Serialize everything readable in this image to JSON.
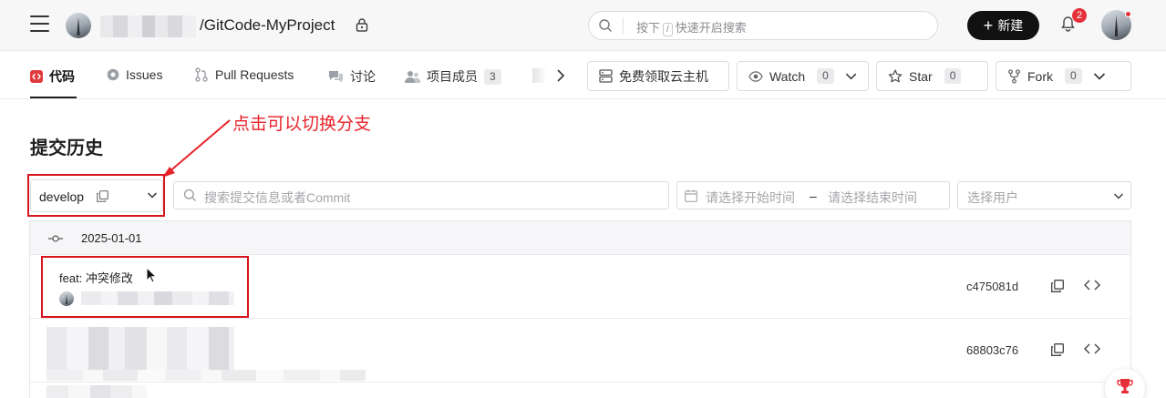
{
  "header": {
    "repo_name": "GitCode-MyProject",
    "search_placeholder_pre": "按下",
    "search_key": "/",
    "search_placeholder_post": "快速开启搜索",
    "new_label": "新建",
    "notification_count": "2"
  },
  "tabs": [
    {
      "label": "代码"
    },
    {
      "label": "Issues"
    },
    {
      "label": "Pull Requests"
    },
    {
      "label": "讨论"
    },
    {
      "label": "项目成员",
      "count": "3"
    }
  ],
  "actions": {
    "cloud_label": "免费领取云主机",
    "watch_label": "Watch",
    "watch_count": "0",
    "star_label": "Star",
    "star_count": "0",
    "fork_label": "Fork",
    "fork_count": "0"
  },
  "page": {
    "title": "提交历史",
    "annotation": "点击可以切换分支"
  },
  "filters": {
    "branch": "develop",
    "search_placeholder": "搜索提交信息或者Commit",
    "start_placeholder": "请选择开始时间",
    "range_sep": "–",
    "end_placeholder": "请选择结束时间",
    "user_placeholder": "选择用户"
  },
  "commits": {
    "date": "2025-01-01",
    "items": [
      {
        "message": "feat: 冲突修改",
        "sha": "c475081d"
      },
      {
        "message": "",
        "sha": "68803c76"
      }
    ]
  },
  "colors": {
    "annotation": "#e8232b",
    "primary_button": "#111111",
    "badge": "#e5303a"
  }
}
